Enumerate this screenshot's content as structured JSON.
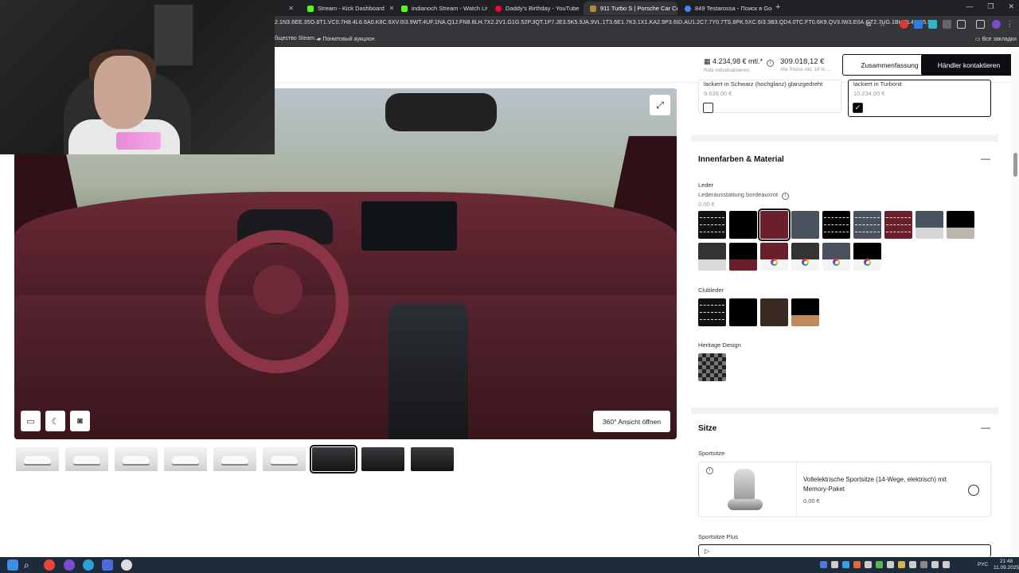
{
  "browser": {
    "tabs": [
      {
        "label": "Stream - Kick Dashboard",
        "color": "#53fc18"
      },
      {
        "label": "indianoch Stream - Watch Live",
        "color": "#53fc18"
      },
      {
        "label": "Daddy's Birthday - YouTube",
        "color": "#ff0033"
      },
      {
        "label": "911 Turbo S | Porsche Car Conf",
        "color": "#b08a3e"
      },
      {
        "label": "849 Testarossa - Поиск в Google",
        "color": "#4285f4"
      }
    ],
    "url": "2.1N3.6EE.35O.8T1.VC0.7H8.4L6.6A0.K8C.6XV.0I3.9WT.4UF.1NA.Q1J.FN8.8LH.7X2.2V1.G1G.52P.3QT.1P7.JE3.5K5.9JA.9VL.1T3.6E1.7K3.1X1.KA2.9P3.6ID.AU1.2C7.7Y0.7TS.8PK.5XC.6I3.3B3.QD4.0TC.FT0.6K9.QV3.IW3.E0A.GT2.7UG.1BH.3L4.0N5.9...",
    "bookmarks": [
      {
        "label": "бщество Steam..."
      },
      {
        "label": "Понмтовый аукцион"
      }
    ],
    "all_bookmarks": "Все закладки"
  },
  "header": {
    "rate_value": "4.234,98 € mtl.*",
    "rate_sub": "Rate individualisieren",
    "total_value": "309.018,12 €",
    "total_sub": "Alle Preise inkl. 19 % ...",
    "summary_button": "Zusammenfassung",
    "dealer_button": "Händler kontaktieren"
  },
  "viewer": {
    "open_360": "360° Ansicht öffnen",
    "expand_icon": "⤢",
    "tool_icons": [
      "▭",
      "☾",
      "◙"
    ]
  },
  "thumbnails": [
    {
      "kind": "exterior",
      "selected": false
    },
    {
      "kind": "exterior",
      "selected": false
    },
    {
      "kind": "exterior",
      "selected": false
    },
    {
      "kind": "exterior",
      "selected": false
    },
    {
      "kind": "exterior",
      "selected": false
    },
    {
      "kind": "exterior",
      "selected": false
    },
    {
      "kind": "interior",
      "selected": true
    },
    {
      "kind": "interior",
      "selected": false
    },
    {
      "kind": "interior",
      "selected": false
    }
  ],
  "top_options": [
    {
      "title": "lackiert in Schwarz (hochglanz) glanzgedreht",
      "price": "9.639,00 €",
      "checked": false
    },
    {
      "title": "lackiert in Turbonit",
      "price": "10.234,00 €",
      "checked": true
    }
  ],
  "interior": {
    "title": "Innenfarben & Material",
    "leather_label": "Leder",
    "leather_selected_name": "Lederausstattung bordeauxrot",
    "leather_price": "0,00 €",
    "leather_swatches": [
      {
        "top": "#111111",
        "bottom": "#111111",
        "stitch": true,
        "selected": false
      },
      {
        "top": "#000000",
        "bottom": "#000000",
        "stitch": false,
        "selected": false
      },
      {
        "top": "#6b1f2b",
        "bottom": "#6b1f2b",
        "stitch": false,
        "selected": true
      },
      {
        "top": "#4a5260",
        "bottom": "#4a5260",
        "stitch": false,
        "selected": false
      },
      {
        "top": "#000000",
        "bottom": "#000000",
        "stitch": true,
        "selected": false
      },
      {
        "top": "#4a5260",
        "bottom": "#4a5260",
        "stitch": true,
        "selected": false
      },
      {
        "top": "#6b1f2b",
        "bottom": "#6b1f2b",
        "stitch": true,
        "selected": false
      },
      {
        "top": "#4a5260",
        "bottom": "#d6d6d6",
        "stitch": false,
        "selected": false
      },
      {
        "top": "#000000",
        "bottom": "#bdb6ab",
        "stitch": false,
        "selected": false
      },
      {
        "top": "#333333",
        "bottom": "#d9d9d9",
        "stitch": false,
        "selected": false
      },
      {
        "top": "#000000",
        "bottom": "#6b1f2b",
        "stitch": false,
        "selected": false
      },
      {
        "top": "#6b1f2b",
        "bottom": "#f4f4f4",
        "stitch": false,
        "selected": false,
        "custom": true
      },
      {
        "top": "#333333",
        "bottom": "#f4f4f4",
        "stitch": false,
        "selected": false,
        "custom": true
      },
      {
        "top": "#4a5260",
        "bottom": "#f4f4f4",
        "stitch": false,
        "selected": false,
        "custom": true
      },
      {
        "top": "#000000",
        "bottom": "#f4f4f4",
        "stitch": false,
        "selected": false,
        "custom": true
      }
    ],
    "club_label": "Clubleder",
    "club_swatches": [
      {
        "top": "#111111",
        "bottom": "#111111",
        "stitch": true
      },
      {
        "top": "#000000",
        "bottom": "#000000",
        "stitch": false
      },
      {
        "top": "#3a2a22",
        "bottom": "#3a2a22",
        "stitch": false
      },
      {
        "top": "#000000",
        "bottom": "#c08a5c",
        "stitch": false
      }
    ],
    "heritage_label": "Heritage Design"
  },
  "seats": {
    "title": "Sitze",
    "sport_label": "Sportsitze",
    "sport_option": "Vollelektrische Sportsitze (14-Wege, elektrisch) mit Memory-Paket",
    "sport_price": "0,00 €",
    "sport_plus_label": "Sportsitze Plus"
  },
  "taskbar": {
    "lang": "РУС",
    "time": "21:48",
    "date": "11.09.2025"
  }
}
